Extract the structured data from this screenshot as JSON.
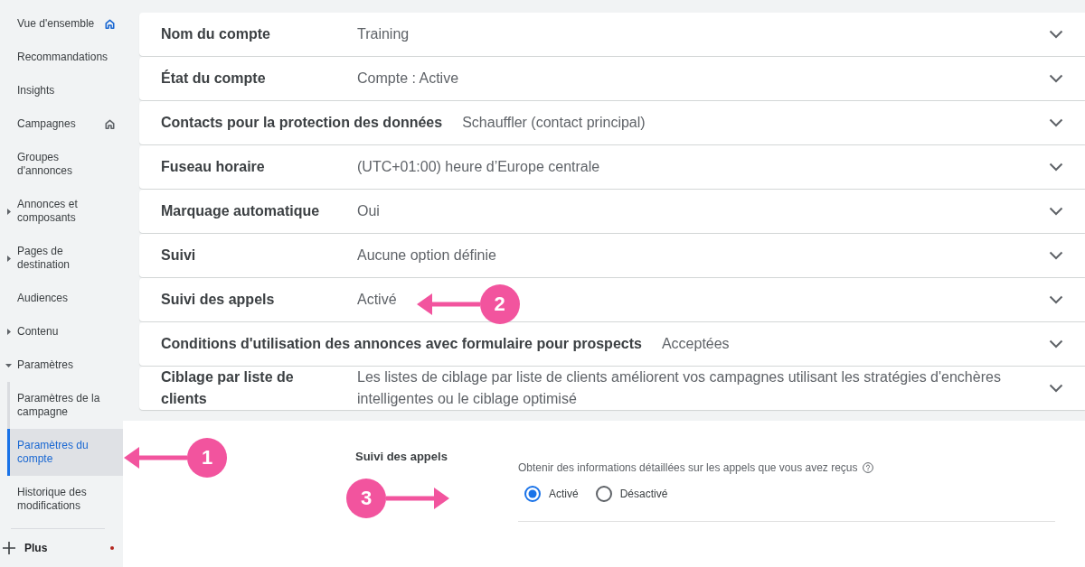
{
  "sidebar": {
    "items": [
      {
        "kind": "link",
        "label": "Vue d'ensemble",
        "selected": false,
        "marker": {
          "color": "#1967d2"
        }
      },
      {
        "kind": "link",
        "label": "Recommandations",
        "selected": false
      },
      {
        "kind": "link",
        "label": "Insights",
        "selected": false
      },
      {
        "kind": "link",
        "label": "Campagnes",
        "selected": false,
        "marker": {
          "color": "#5f6368"
        }
      },
      {
        "kind": "link",
        "label": "Groupes d'annonces",
        "selected": false
      },
      {
        "kind": "group",
        "label": "Annonces et composants",
        "selected": false,
        "expanded": false
      },
      {
        "kind": "group",
        "label": "Pages de destination",
        "selected": false,
        "expanded": false
      },
      {
        "kind": "link",
        "label": "Audiences",
        "selected": false
      },
      {
        "kind": "group",
        "label": "Contenu",
        "selected": false,
        "expanded": false
      },
      {
        "kind": "group",
        "label": "Paramètres",
        "selected": false,
        "expanded": true,
        "children": [
          {
            "label": "Paramètres de la campagne",
            "selected": false
          },
          {
            "label": "Paramètres du compte",
            "selected": true,
            "callout": "1"
          }
        ]
      },
      {
        "kind": "link",
        "label": "Historique des modifications",
        "selected": false
      }
    ],
    "more": {
      "label": "Plus",
      "notification": true
    }
  },
  "settings": [
    {
      "label": "Nom du compte",
      "value": "Training",
      "expanded": false
    },
    {
      "label": "État du compte",
      "value": "Compte : Active",
      "expanded": false
    },
    {
      "label": "Contacts pour la protection des données",
      "value": "Schauffler (contact principal)",
      "expanded": false
    },
    {
      "label": "Fuseau horaire",
      "value": "(UTC+01:00) heure d’Europe centrale",
      "expanded": false
    },
    {
      "label": "Marquage automatique",
      "value": "Oui",
      "expanded": false
    },
    {
      "label": "Suivi",
      "value": "Aucune option définie",
      "expanded": false
    },
    {
      "label": "Suivi des appels",
      "value": "Activé",
      "expanded": false,
      "callout": "2"
    },
    {
      "label": "Conditions d'utilisation des annonces avec formulaire pour prospects",
      "value": "Acceptées",
      "expanded": false
    },
    {
      "label": "Ciblage par liste de clients",
      "value": "Les listes de ciblage par liste de clients améliorent vos campagnes utilisant les stratégies d'enchères intelligentes ou le ciblage optimisé",
      "expanded": false
    }
  ],
  "detail": {
    "title": "Suivi des appels",
    "description": "Obtenir des informations détaillées sur les appels que vous avez reçus",
    "options": [
      {
        "label": "Activé",
        "selected": true
      },
      {
        "label": "Désactivé",
        "selected": false
      }
    ],
    "callout": "3"
  }
}
